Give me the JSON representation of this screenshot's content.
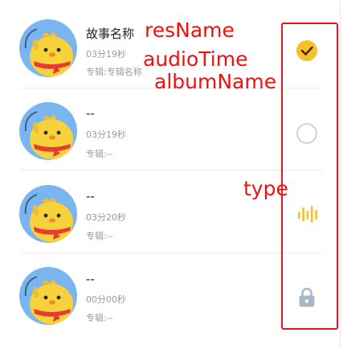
{
  "list": {
    "items": [
      {
        "title": "故事名称",
        "time": "03分19秒",
        "album": "专辑:专辑名称",
        "status_icon": "check-circle-icon"
      },
      {
        "title": "--",
        "time": "03分19秒",
        "album": "专辑:--",
        "status_icon": "radio-empty-icon"
      },
      {
        "title": "--",
        "time": "03分20秒",
        "album": "专辑:--",
        "status_icon": "audio-playing-icon"
      },
      {
        "title": "--",
        "time": "00分00秒",
        "album": "专辑:--",
        "status_icon": "lock-icon"
      }
    ]
  },
  "annotations": {
    "res_name": "resName",
    "audio_time": "audioTime",
    "album_name": "albumName",
    "type": "type"
  },
  "colors": {
    "accent_yellow": "#f6c028",
    "annotation_red": "#ee1111",
    "lock_gray": "#a9b7c6",
    "ring_gray": "#c8c8c8"
  }
}
